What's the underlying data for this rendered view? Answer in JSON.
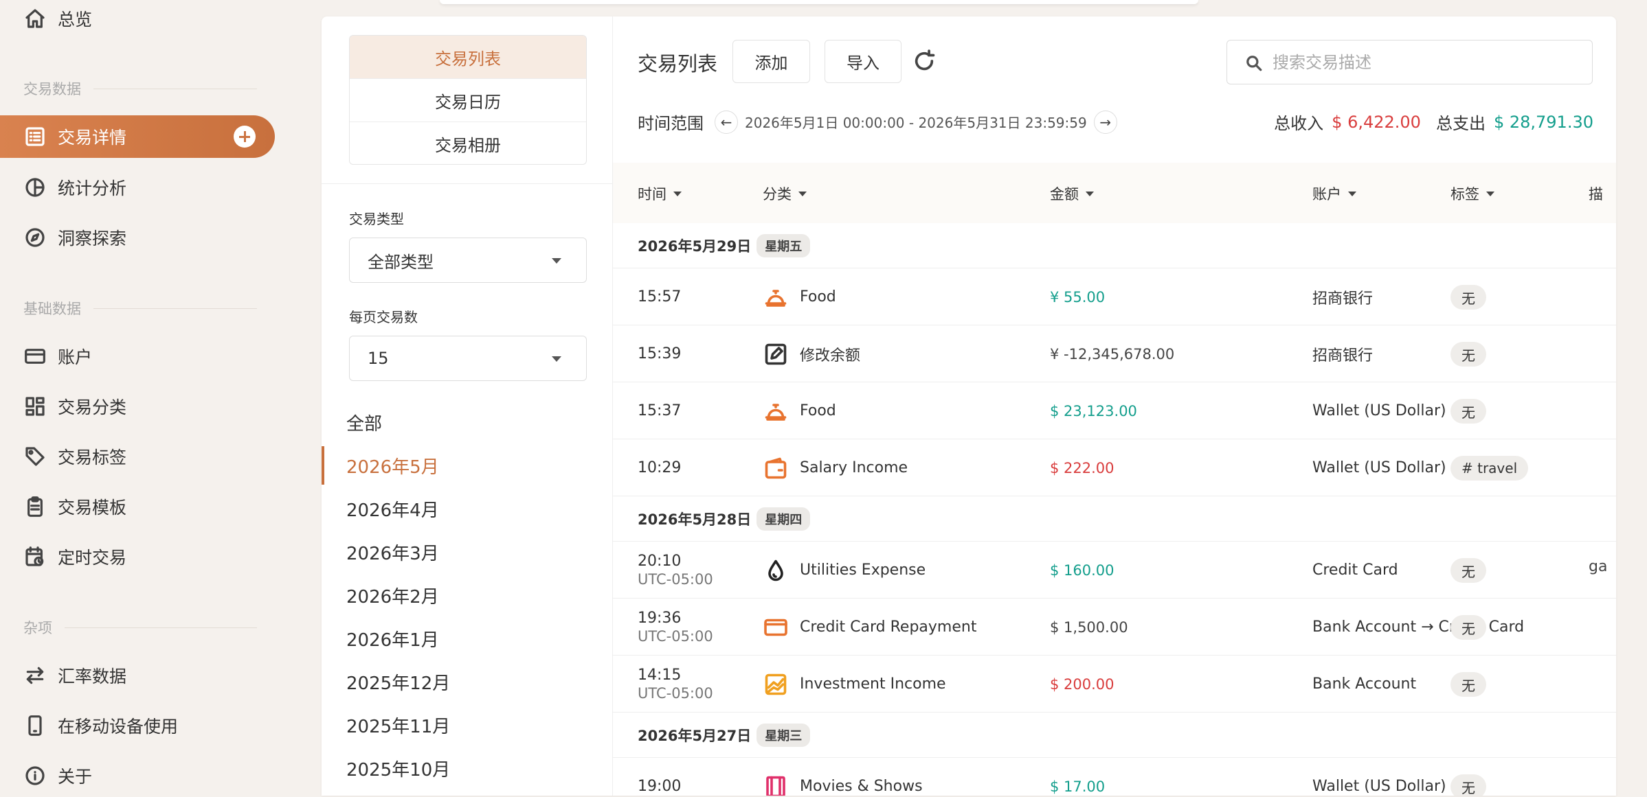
{
  "sidebar": {
    "overview": "总览",
    "sections": [
      {
        "label": "交易数据"
      },
      {
        "label": "基础数据"
      },
      {
        "label": "杂项"
      }
    ],
    "items": [
      {
        "label": "交易详情",
        "icon": "list-icon"
      },
      {
        "label": "统计分析",
        "icon": "pie-chart-icon"
      },
      {
        "label": "洞察探索",
        "icon": "compass-icon"
      },
      {
        "label": "账户",
        "icon": "credit-card-icon"
      },
      {
        "label": "交易分类",
        "icon": "grid-icon"
      },
      {
        "label": "交易标签",
        "icon": "tag-icon"
      },
      {
        "label": "交易模板",
        "icon": "clipboard-icon"
      },
      {
        "label": "定时交易",
        "icon": "calendar-clock-icon"
      },
      {
        "label": "汇率数据",
        "icon": "swap-icon"
      },
      {
        "label": "在移动设备使用",
        "icon": "phone-icon"
      },
      {
        "label": "关于",
        "icon": "info-icon"
      }
    ]
  },
  "filters": {
    "view_tabs": [
      "交易列表",
      "交易日历",
      "交易相册"
    ],
    "type_label": "交易类型",
    "type_value": "全部类型",
    "per_page_label": "每页交易数",
    "per_page_value": "15",
    "months": [
      "全部",
      "2026年5月",
      "2026年4月",
      "2026年3月",
      "2026年2月",
      "2026年1月",
      "2025年12月",
      "2025年11月",
      "2025年10月"
    ]
  },
  "toolbar": {
    "title": "交易列表",
    "add_label": "添加",
    "import_label": "导入",
    "search_placeholder": "搜索交易描述",
    "range_label": "时间范围",
    "range_text": "2026年5月1日 00:00:00 - 2026年5月31日 23:59:59",
    "income_label": "总收入",
    "income_value": "$ 6,422.00",
    "expense_label": "总支出",
    "expense_value": "$ 28,791.30"
  },
  "columns": [
    "时间",
    "分类",
    "金额",
    "账户",
    "标签",
    "描"
  ],
  "groups": [
    {
      "date": "2026年5月29日",
      "weekday": "星期五",
      "rows": [
        {
          "time": "15:57",
          "tz": "",
          "category": "Food",
          "icon": "food-cloche-icon",
          "amount": "¥ 55.00",
          "account": "招商银行",
          "tag": "无",
          "desc": ""
        },
        {
          "time": "15:39",
          "tz": "",
          "category": "修改余额",
          "icon": "edit-square-icon",
          "amount": "¥ -12,345,678.00",
          "account": "招商银行",
          "tag": "无",
          "desc": ""
        },
        {
          "time": "15:37",
          "tz": "",
          "category": "Food",
          "icon": "food-cloche-icon",
          "amount": "$ 23,123.00",
          "account": "Wallet (US Dollar)",
          "tag": "无",
          "desc": ""
        },
        {
          "time": "10:29",
          "tz": "",
          "category": "Salary Income",
          "icon": "wallet-icon",
          "amount": "$ 222.00",
          "account": "Wallet (US Dollar)",
          "tag": "# travel",
          "desc": ""
        }
      ]
    },
    {
      "date": "2026年5月28日",
      "weekday": "星期四",
      "rows": [
        {
          "time": "20:10",
          "tz": "UTC-05:00",
          "category": "Utilities Expense",
          "icon": "water-drop-icon",
          "amount": "$ 160.00",
          "account": "Credit Card",
          "tag": "无",
          "desc": "ga"
        },
        {
          "time": "19:36",
          "tz": "UTC-05:00",
          "category": "Credit Card Repayment",
          "icon": "card-icon",
          "amount": "$ 1,500.00",
          "account": "Bank Account → Credit Card",
          "tag": "无",
          "desc": ""
        },
        {
          "time": "14:15",
          "tz": "UTC-05:00",
          "category": "Investment Income",
          "icon": "chart-line-icon",
          "amount": "$ 200.00",
          "account": "Bank Account",
          "tag": "无",
          "desc": ""
        }
      ]
    },
    {
      "date": "2026年5月27日",
      "weekday": "星期三",
      "rows": [
        {
          "time": "19:00",
          "tz": "",
          "category": "Movies & Shows",
          "icon": "film-icon",
          "amount": "$ 17.00",
          "account": "Wallet (US Dollar)",
          "tag": "无",
          "desc": ""
        }
      ]
    }
  ],
  "colors": {
    "accent": "#c8703d",
    "income": "#d93c3c",
    "expense": "#139e8c",
    "icon_orange": "#e8732f"
  }
}
